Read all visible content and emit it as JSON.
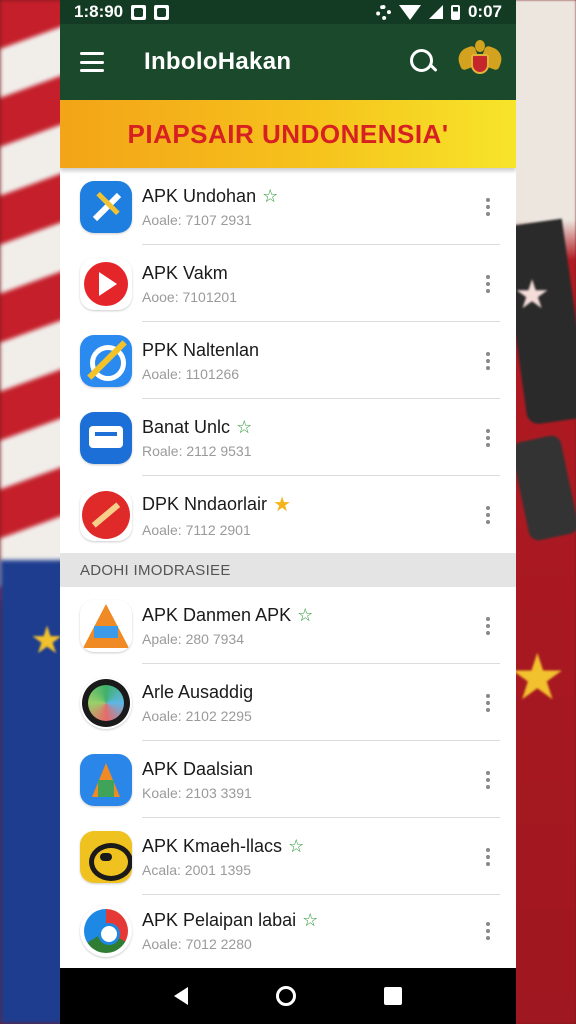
{
  "status_bar": {
    "time_left": "1:8:90",
    "time_right": "0:07"
  },
  "app_bar": {
    "title": "InboloHakan"
  },
  "banner": {
    "text": "PIAPSAIR UNDONENSIA'"
  },
  "apps_top": [
    {
      "name": "APK Undohan",
      "meta": "Aoale: 7107 2931",
      "icon": "blue-compass-icon",
      "badge": "outline-star"
    },
    {
      "name": "APK Vakm",
      "meta": "Aooe: 7101201",
      "icon": "red-play-icon",
      "badge": ""
    },
    {
      "name": "PPK Naltenlan",
      "meta": "Aoale: 1101266",
      "icon": "blue-slash-icon",
      "badge": ""
    },
    {
      "name": "Banat Unlc",
      "meta": "Roale: 2112 9531",
      "icon": "blue-briefcase-icon",
      "badge": "outline-star"
    },
    {
      "name": "DPK Nndaorlair",
      "meta": "Aoale: 7112 2901",
      "icon": "red-pen-icon",
      "badge": "filled-star"
    }
  ],
  "section": {
    "title": "ADOHI IMODRASIEE"
  },
  "apps_bottom": [
    {
      "name": "APK Danmen APK",
      "meta": "Apale: 280 7934",
      "icon": "multicolor-a-icon",
      "badge": "outline-star"
    },
    {
      "name": "Arle Ausaddig",
      "meta": "Aoale: 2102 2295",
      "icon": "globe-icon",
      "badge": ""
    },
    {
      "name": "APK Daalsian",
      "meta": "Koale: 2103 3391",
      "icon": "blue-a-icon",
      "badge": ""
    },
    {
      "name": "APK Kmaeh-llacs",
      "meta": "Acala: 2001 1395",
      "icon": "gold-emblem-icon",
      "badge": "outline-star"
    },
    {
      "name": "APK Pelaipan labai",
      "meta": "Aoale: 7012 2280",
      "icon": "chrome-icon",
      "badge": "outline-star"
    }
  ]
}
